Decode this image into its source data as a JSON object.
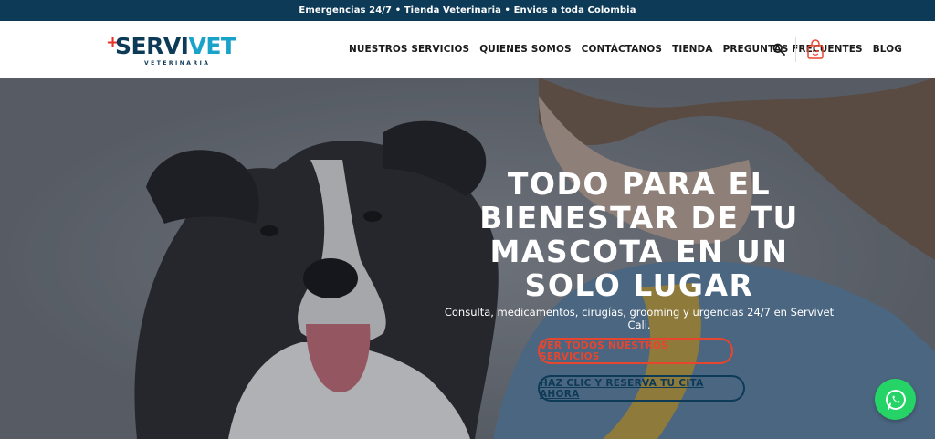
{
  "topbar": {
    "text": "Emergencias 24/7 • Tienda Veterinaria • Envios a toda Colombia"
  },
  "logo": {
    "plus": "+",
    "serv": "SERVI",
    "vet": "VET",
    "sub": "VETERINARIA"
  },
  "nav": {
    "items": [
      {
        "label": "NUESTROS SERVICIOS"
      },
      {
        "label": "QUIENES SOMOS"
      },
      {
        "label": "CONTÁCTANOS"
      },
      {
        "label": "TIENDA"
      },
      {
        "label": "PREGUNTAS FRECUENTES"
      },
      {
        "label": "BLOG"
      }
    ],
    "icons": {
      "search": "search-icon",
      "cart": "shopping-bag-icon"
    }
  },
  "hero": {
    "title": "TODO PARA EL BIENESTAR DE TU MASCOTA EN UN SOLO LUGAR",
    "subtitle": "Consulta, medicamentos, cirugías, grooming y urgencias 24/7 en Servivet Cali.",
    "buttons": {
      "services": "VER TODOS NUESTROS SERVICIOS",
      "reserve": "HAZ CLIC Y RESERVA TU CITA AHORA"
    }
  },
  "floating": {
    "icon": "whatsapp-icon"
  },
  "colors": {
    "topbar": "#0d3a57",
    "brand_dark": "#0d3a57",
    "brand_light": "#1aa3c8",
    "accent_red": "#e8452f",
    "whatsapp": "#25d366"
  }
}
